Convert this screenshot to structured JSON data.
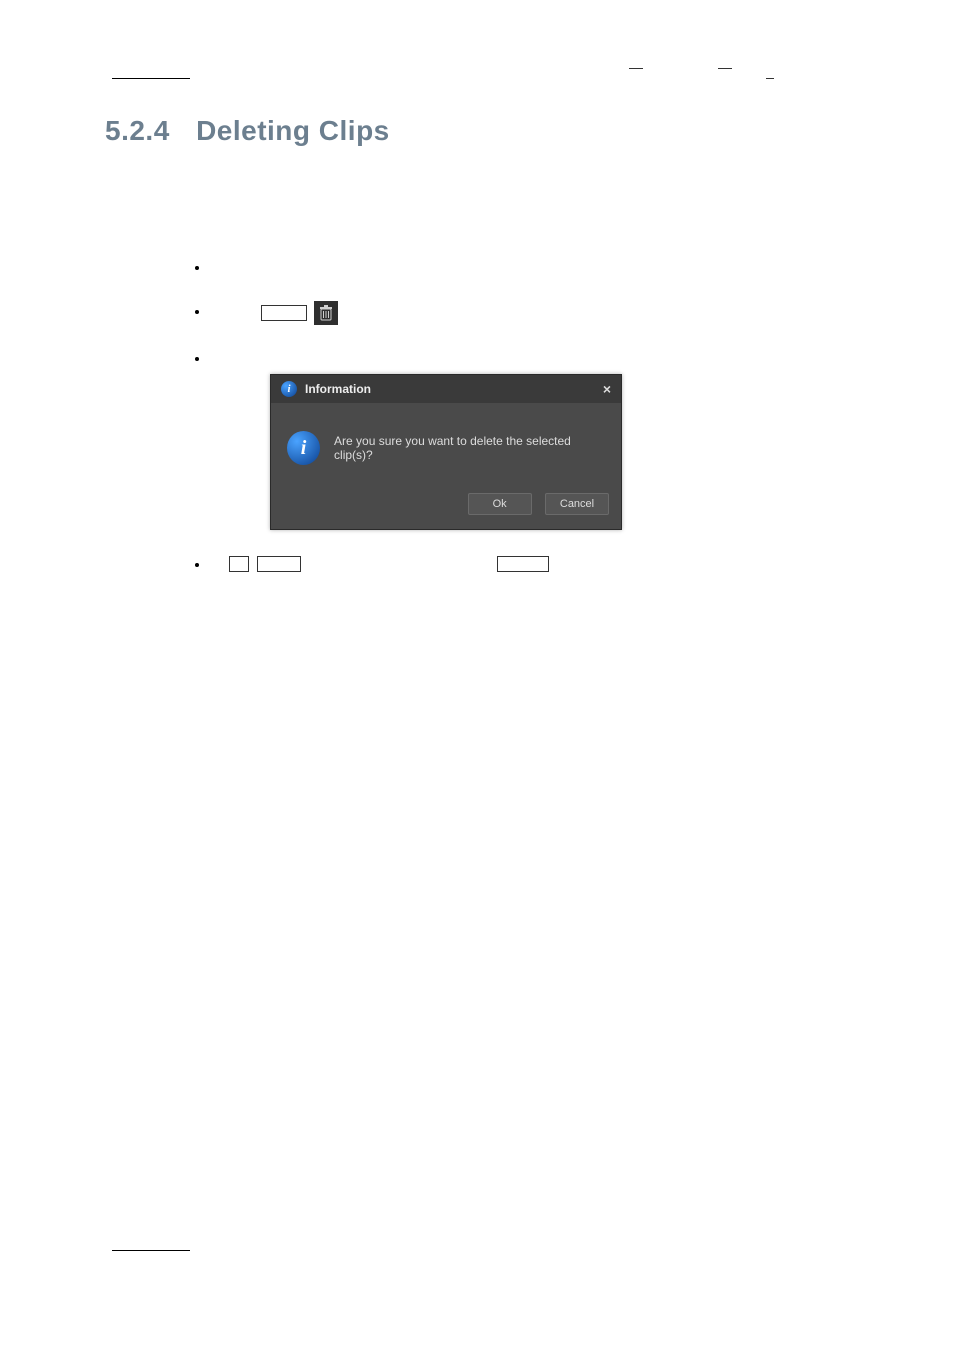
{
  "heading": {
    "number": "5.2.4",
    "title": "Deleting Clips"
  },
  "list": {
    "li2_btn_label": "",
    "trash_icon_name": "trash-icon"
  },
  "dialog": {
    "title": "Information",
    "message": "Are you sure you want to delete the selected clip(s)?",
    "ok": "Ok",
    "cancel": "Cancel",
    "close": "×"
  }
}
